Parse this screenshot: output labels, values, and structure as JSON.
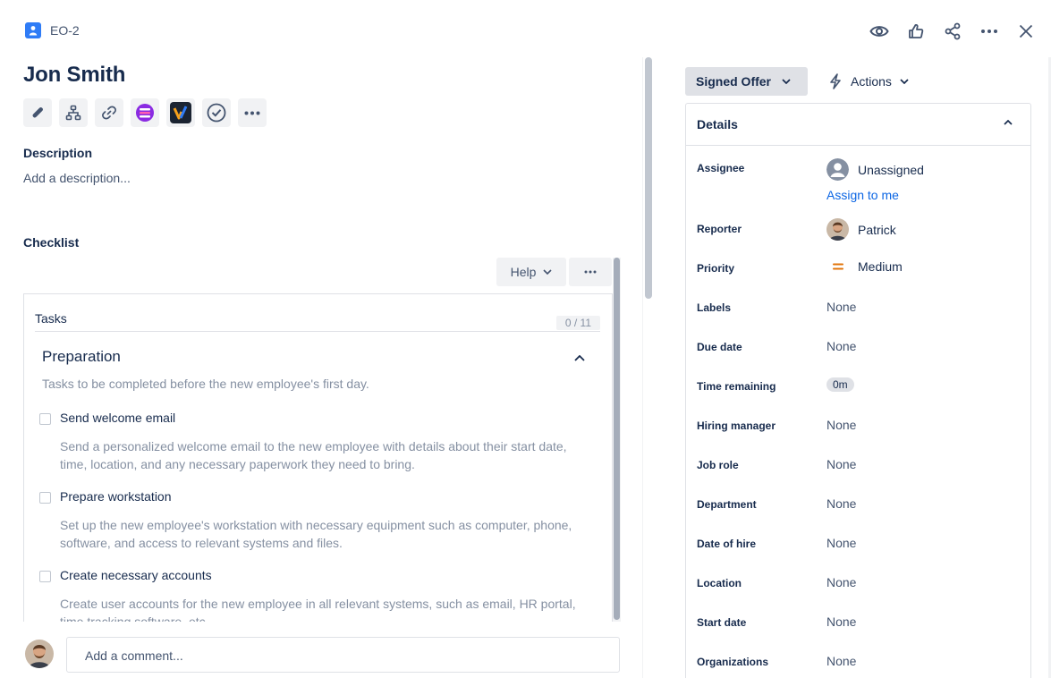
{
  "header": {
    "issue_key": "EO-2",
    "actions": [
      {
        "name": "watch-icon"
      },
      {
        "name": "thumbs-up-icon"
      },
      {
        "name": "share-icon"
      },
      {
        "name": "more-icon"
      },
      {
        "name": "close-icon"
      }
    ]
  },
  "issue": {
    "title": "Jon Smith"
  },
  "toolbar": {
    "buttons": [
      "attachment-icon",
      "child-issue-icon",
      "link-icon",
      "app-icon-purple",
      "app-icon-v",
      "checklist-icon",
      "more-icon"
    ]
  },
  "description": {
    "label": "Description",
    "placeholder": "Add a description..."
  },
  "checklist": {
    "label": "Checklist",
    "help_label": "Help",
    "header": "Tasks",
    "count": "0 / 11",
    "section": {
      "title": "Preparation",
      "description": "Tasks to be completed before the new employee's first day."
    },
    "tasks": [
      {
        "title": "Send welcome email",
        "description": "Send a personalized welcome email to the new employee with details about their start date, time, location, and any necessary paperwork they need to bring.",
        "checked": false
      },
      {
        "title": "Prepare workstation",
        "description": "Set up the new employee's workstation with necessary equipment such as computer, phone, software, and access to relevant systems and files.",
        "checked": false
      },
      {
        "title": "Create necessary accounts",
        "description": "Create user accounts for the new employee in all relevant systems, such as email, HR portal, time tracking software, etc.",
        "checked": false
      }
    ]
  },
  "comment": {
    "placeholder": "Add a comment..."
  },
  "status": {
    "label": "Signed Offer",
    "actions_label": "Actions"
  },
  "details": {
    "title": "Details",
    "assignee_label": "Assignee",
    "assignee_value": "Unassigned",
    "assign_to_me": "Assign to me",
    "reporter_label": "Reporter",
    "reporter_value": "Patrick",
    "priority_label": "Priority",
    "priority_value": "Medium",
    "priority_color": "#e2740b",
    "labels_label": "Labels",
    "labels_value": "None",
    "due_label": "Due date",
    "due_value": "None",
    "time_label": "Time remaining",
    "time_value": "0m",
    "hiring_label": "Hiring manager",
    "hiring_value": "None",
    "job_label": "Job role",
    "job_value": "None",
    "dept_label": "Department",
    "dept_value": "None",
    "hire_date_label": "Date of hire",
    "hire_date_value": "None",
    "location_label": "Location",
    "location_value": "None",
    "start_label": "Start date",
    "start_value": "None",
    "org_label": "Organizations",
    "org_value": "None"
  }
}
